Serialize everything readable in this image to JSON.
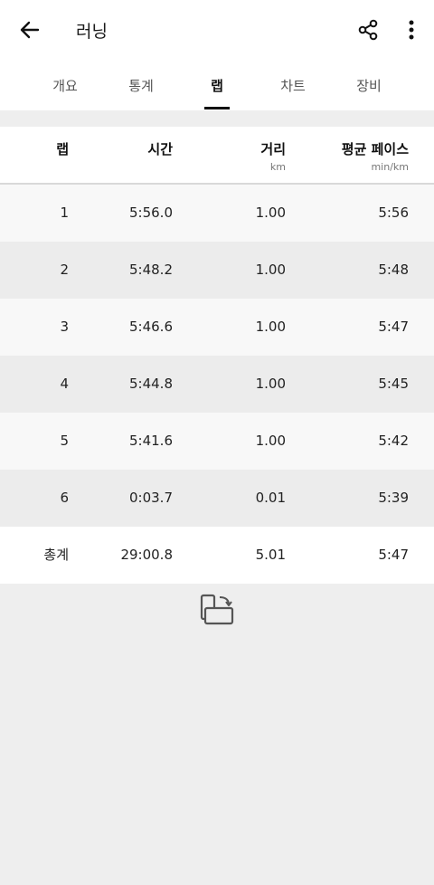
{
  "appbar": {
    "title": "러닝",
    "icons": {
      "back": "arrow-left-icon",
      "share": "share-icon",
      "more": "more-vertical-icon"
    }
  },
  "tabs": [
    {
      "label": "개요",
      "active": false
    },
    {
      "label": "통계",
      "active": false
    },
    {
      "label": "랩",
      "active": true
    },
    {
      "label": "차트",
      "active": false
    },
    {
      "label": "장비",
      "active": false
    }
  ],
  "table": {
    "headers": {
      "lap": "랩",
      "time": "시간",
      "distance": "거리",
      "distance_unit": "km",
      "pace": "평균 페이스",
      "pace_unit": "min/km"
    },
    "rows": [
      {
        "lap": "1",
        "time": "5:56.0",
        "distance": "1.00",
        "pace": "5:56"
      },
      {
        "lap": "2",
        "time": "5:48.2",
        "distance": "1.00",
        "pace": "5:48"
      },
      {
        "lap": "3",
        "time": "5:46.6",
        "distance": "1.00",
        "pace": "5:47"
      },
      {
        "lap": "4",
        "time": "5:44.8",
        "distance": "1.00",
        "pace": "5:45"
      },
      {
        "lap": "5",
        "time": "5:41.6",
        "distance": "1.00",
        "pace": "5:42"
      },
      {
        "lap": "6",
        "time": "0:03.7",
        "distance": "0.01",
        "pace": "5:39"
      }
    ],
    "total": {
      "lap": "총계",
      "time": "29:00.8",
      "distance": "5.01",
      "pace": "5:47"
    }
  },
  "footer": {
    "rotate_icon": "screen-rotate-icon"
  },
  "colors": {
    "background": "#eeeeee",
    "surface": "#ffffff",
    "accent": "#111111"
  }
}
